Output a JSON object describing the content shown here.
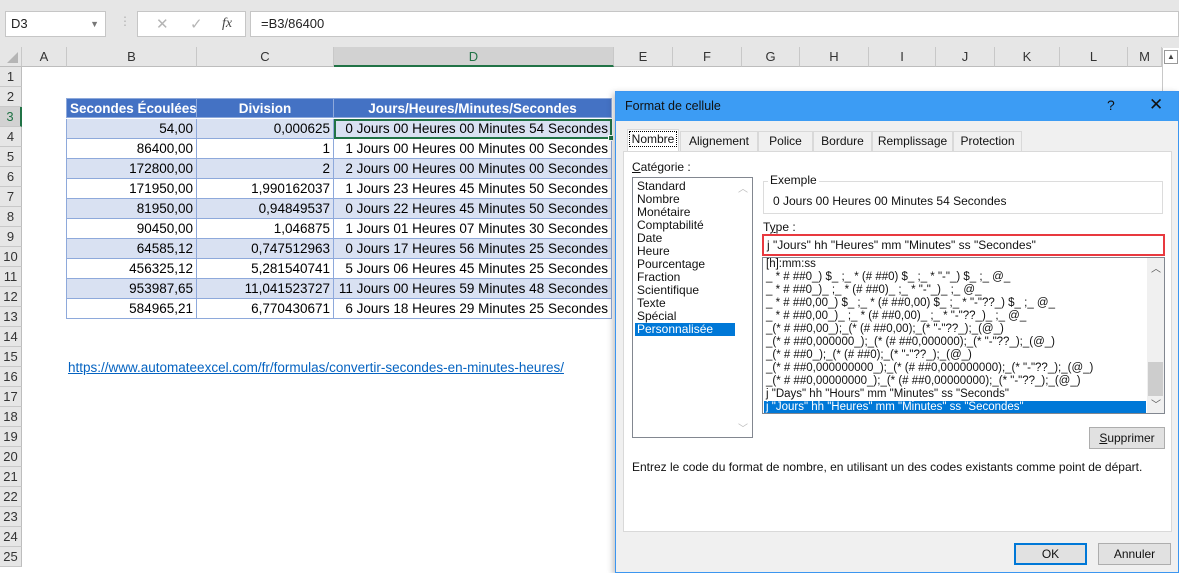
{
  "formula_bar": {
    "name_box": "D3",
    "cancel_icon": "✕",
    "enter_icon": "✓",
    "fx_label": "fx",
    "formula": "=B3/86400"
  },
  "columns": [
    "A",
    "B",
    "C",
    "D",
    "E",
    "F",
    "G",
    "H",
    "I",
    "J",
    "K",
    "L",
    "M"
  ],
  "rows": [
    "1",
    "2",
    "3",
    "4",
    "5",
    "6",
    "7",
    "8",
    "9",
    "10",
    "11",
    "12",
    "13",
    "14",
    "15",
    "16",
    "17",
    "18",
    "19",
    "20",
    "21",
    "22",
    "23",
    "24",
    "25"
  ],
  "selected_cell": "D3",
  "table": {
    "headers": [
      "Secondes Écoulées",
      "Division",
      "Jours/Heures/Minutes/Secondes"
    ],
    "rows": [
      [
        "54,00",
        "0,000625",
        "0 Jours 00 Heures 00 Minutes 54 Secondes"
      ],
      [
        "86400,00",
        "1",
        "1 Jours 00 Heures 00 Minutes 00 Secondes"
      ],
      [
        "172800,00",
        "2",
        "2 Jours 00 Heures 00 Minutes 00 Secondes"
      ],
      [
        "171950,00",
        "1,990162037",
        "1 Jours 23 Heures 45 Minutes 50 Secondes"
      ],
      [
        "81950,00",
        "0,94849537",
        "0 Jours 22 Heures 45 Minutes 50 Secondes"
      ],
      [
        "90450,00",
        "1,046875",
        "1 Jours 01 Heures 07 Minutes 30 Secondes"
      ],
      [
        "64585,12",
        "0,747512963",
        "0 Jours 17 Heures 56 Minutes 25 Secondes"
      ],
      [
        "456325,12",
        "5,281540741",
        "5 Jours 06 Heures 45 Minutes 25 Secondes"
      ],
      [
        "953987,65",
        "11,041523727",
        "11 Jours 00 Heures 59 Minutes 48 Secondes"
      ],
      [
        "584965,21",
        "6,770430671",
        "6 Jours 18 Heures 29 Minutes 25 Secondes"
      ]
    ]
  },
  "link": "https://www.automateexcel.com/fr/formulas/convertir-secondes-en-minutes-heures/",
  "dialog": {
    "title": "Format de cellule",
    "help": "?",
    "close": "✕",
    "tabs": [
      "Nombre",
      "Alignement",
      "Police",
      "Bordure",
      "Remplissage",
      "Protection"
    ],
    "active_tab": "Nombre",
    "category_label": "Catégorie :",
    "categories": [
      "Standard",
      "Nombre",
      "Monétaire",
      "Comptabilité",
      "Date",
      "Heure",
      "Pourcentage",
      "Fraction",
      "Scientifique",
      "Texte",
      "Spécial",
      "Personnalisée"
    ],
    "selected_category": "Personnalisée",
    "example_label": "Exemple",
    "example_value": "0 Jours 00 Heures 00 Minutes 54 Secondes",
    "type_label": "Type :",
    "type_value": "j \"Jours\" hh \"Heures\" mm \"Minutes\" ss \"Secondes\"",
    "type_list": [
      "[h]:mm:ss",
      "_ * # ##0_) $_ ;_ * (# ##0) $_ ;_ * \"-\"_) $_ ;_ @_",
      "_ * # ##0_)_ ;_ * (# ##0)_ ;_ * \"-\"_)_ ;_ @_",
      "_ * # ##0,00_) $_ ;_ * (# ##0,00) $_ ;_ * \"-\"??_) $_ ;_ @_",
      "_ * # ##0,00_)_ ;_ * (# ##0,00)_ ;_ * \"-\"??_)_ ;_ @_",
      "_(* # ##0,00_);_(* (# ##0,00);_(* \"-\"??_);_(@_)",
      "_(* # ##0,000000_);_(* (# ##0,000000);_(* \"-\"??_);_(@_)",
      "_(* # ##0_);_(* (# ##0);_(* \"-\"??_);_(@_)",
      "_(* # ##0,000000000_);_(* (# ##0,000000000);_(* \"-\"??_);_(@_)",
      "_(* # ##0,00000000_);_(* (# ##0,00000000);_(* \"-\"??_);_(@_)",
      "j \"Days\" hh \"Hours\" mm \"Minutes\" ss \"Seconds\"",
      "j \"Jours\" hh \"Heures\" mm \"Minutes\" ss \"Secondes\""
    ],
    "selected_type_index": 11,
    "delete_button": "Supprimer",
    "hint": "Entrez le code du format de nombre, en utilisant un des codes existants comme point de départ.",
    "ok_button": "OK",
    "cancel_button": "Annuler"
  },
  "colors": {
    "header_fill": "#4472c4",
    "band_fill": "#d9e1f2",
    "selection_green": "#217346",
    "dialog_titlebar": "#3c9cf4",
    "list_selection": "#0078d7",
    "type_highlight": "#e8393f",
    "link": "#0563c1"
  }
}
